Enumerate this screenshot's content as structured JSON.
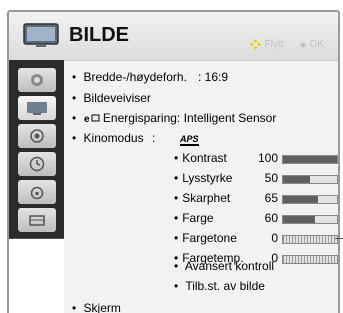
{
  "header": {
    "title": "BILDE",
    "hint_move": "Flytt",
    "hint_ok": "OK",
    "tv_icon": "tv-screen-icon"
  },
  "sidebar": {
    "items": [
      {
        "name": "picture-icon",
        "active": false
      },
      {
        "name": "tv-icon",
        "active": true
      },
      {
        "name": "audio-icon",
        "active": false
      },
      {
        "name": "clock-icon",
        "active": false
      },
      {
        "name": "lock-icon",
        "active": false
      },
      {
        "name": "option-icon",
        "active": false
      }
    ]
  },
  "menu": {
    "aspect_label": "Bredde-/høydeforh.",
    "aspect_value": ": 16:9",
    "wizard_label": "Bildeveiviser",
    "energy_label": "Energisparing: Intelligent Sensor",
    "cinema_label": "Kinomodus",
    "cinema_colon": ":",
    "aps_label": "APS",
    "advanced_label": "Avansert kontroll",
    "reset_label": "Tilb.st. av bilde",
    "screen_label": "Skjerm"
  },
  "settings": [
    {
      "label": "Kontrast",
      "value": "100",
      "level": 1.0,
      "style": "fill"
    },
    {
      "label": "Lysstyrke",
      "value": "50",
      "level": 0.5,
      "style": "fill"
    },
    {
      "label": "Skarphet",
      "value": "65",
      "level": 0.65,
      "style": "fill"
    },
    {
      "label": "Farge",
      "value": "60",
      "level": 0.6,
      "style": "fill"
    },
    {
      "label": "Fargetone",
      "value": "0",
      "level": 0.0,
      "style": "hatched"
    },
    {
      "label": "Fargetemp.",
      "value": "0",
      "level": 0.0,
      "style": "hatched"
    }
  ],
  "colors": {
    "sidebar_bg": "#2b2b2b",
    "bar_fill": "#606060",
    "header_bg": "#dcdcdc"
  }
}
